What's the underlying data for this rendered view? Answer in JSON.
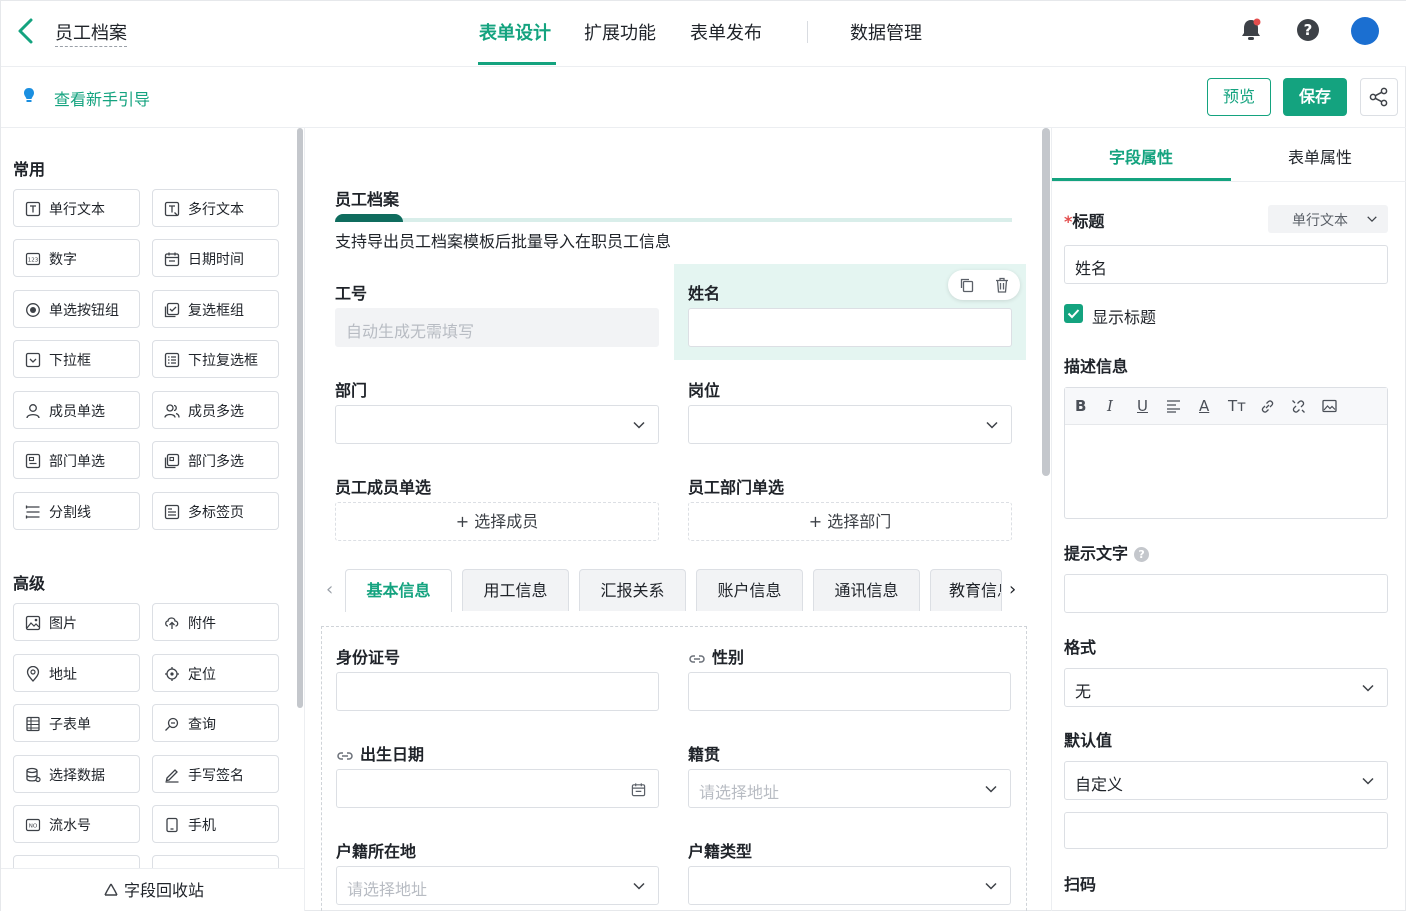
{
  "header": {
    "app_title": "员工档案",
    "nav": [
      "表单设计",
      "扩展功能",
      "表单发布",
      "数据管理"
    ]
  },
  "subbar": {
    "guide": "查看新手引导",
    "preview": "预览",
    "save": "保存"
  },
  "palette": {
    "common_title": "常用",
    "common": [
      "单行文本",
      "多行文本",
      "数字",
      "日期时间",
      "单选按钮组",
      "复选框组",
      "下拉框",
      "下拉复选框",
      "成员单选",
      "成员多选",
      "部门单选",
      "部门多选",
      "分割线",
      "多标签页"
    ],
    "advanced_title": "高级",
    "advanced": [
      "图片",
      "附件",
      "地址",
      "定位",
      "子表单",
      "查询",
      "选择数据",
      "手写签名",
      "流水号",
      "手机"
    ],
    "recycle": "字段回收站"
  },
  "form": {
    "title": "员工档案",
    "desc": "支持导出员工档案模板后批量导入在职员工信息",
    "fields": {
      "job_no": {
        "label": "工号",
        "placeholder": "自动生成无需填写"
      },
      "name": {
        "label": "姓名"
      },
      "dept": {
        "label": "部门"
      },
      "post": {
        "label": "岗位"
      },
      "member": {
        "label": "员工成员单选",
        "button": "+ 选择成员"
      },
      "dept_single": {
        "label": "员工部门单选",
        "button": "+ 选择部门"
      }
    },
    "tabs": [
      "基本信息",
      "用工信息",
      "汇报关系",
      "账户信息",
      "通讯信息",
      "教育信息"
    ],
    "tab_fields": {
      "id_no": "身份证号",
      "gender": "性别",
      "birth": "出生日期",
      "native": {
        "label": "籍贯",
        "placeholder": "请选择地址"
      },
      "domicile": {
        "label": "户籍所在地",
        "placeholder": "请选择地址"
      },
      "domicile_type": "户籍类型"
    }
  },
  "props": {
    "tabs": [
      "字段属性",
      "表单属性"
    ],
    "title_label": "标题",
    "title_required_mark": "*",
    "field_type": "单行文本",
    "title_value": "姓名",
    "show_title": "显示标题",
    "desc_label": "描述信息",
    "hint_label": "提示文字",
    "hint_help": "?",
    "format_label": "格式",
    "format_value": "无",
    "default_label": "默认值",
    "default_value": "自定义",
    "scan_label": "扫码"
  },
  "colors": {
    "accent": "#14a37f",
    "selected_bg": "#e4f5f1"
  }
}
